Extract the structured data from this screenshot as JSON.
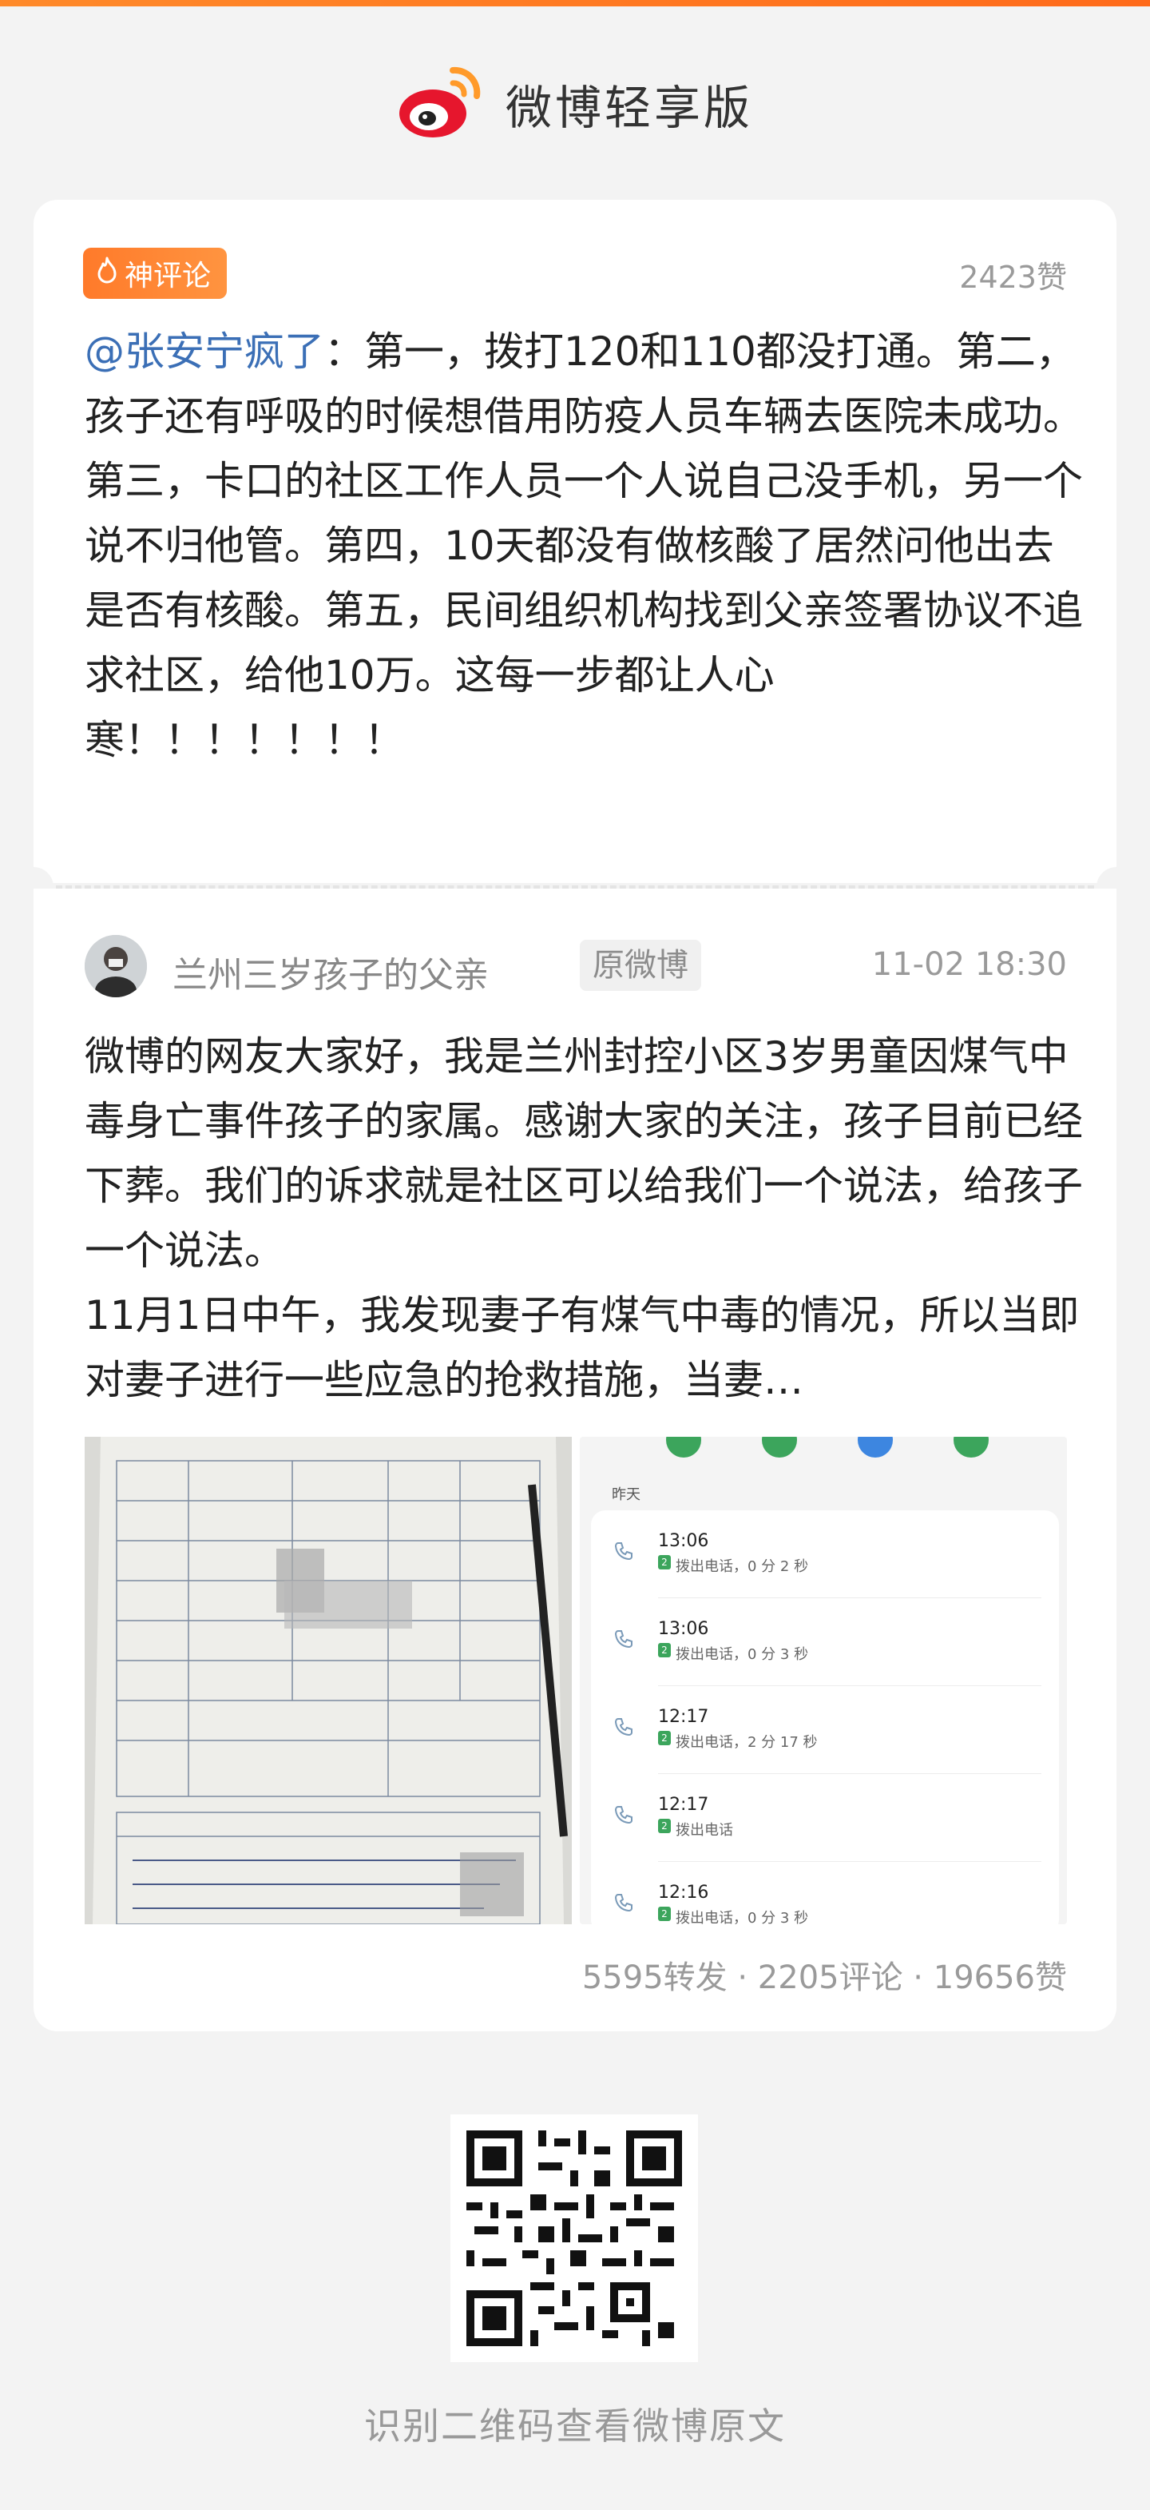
{
  "header": {
    "app_title": "微博轻享版"
  },
  "comment": {
    "badge": "神评论",
    "likes": "2423赞",
    "mention": "@张安宁疯了",
    "text": "：第一，拨打120和110都没打通。第二，孩子还有呼吸的时候想借用防疫人员车辆去医院未成功。第三，卡口的社区工作人员一个人说自己没手机，另一个说不归他管。第四，10天都没有做核酸了居然问他出去是否有核酸。第五，民间组织机构找到父亲签署协议不追求社区，给他10万。这每一步都让人心寒！！！！！！！"
  },
  "original": {
    "username": "兰州三岁孩子的父亲",
    "tag": "原微博",
    "time": "11-02 18:30",
    "text": "微博的网友大家好，我是兰州封控小区3岁男童因煤气中毒身亡事件孩子的家属。感谢大家的关注，孩子目前已经下葬。我们的诉求就是社区可以给我们一个说法，给孩子一个说法。\n11月1日中午，我发现妻子有煤气中毒的情况，所以当即对妻子进行一些应急的抢救措施，当妻…",
    "stats": "5595转发 · 2205评论 · 19656赞",
    "call_log": {
      "date_label": "昨天",
      "items": [
        {
          "time": "13:06",
          "sim": "2",
          "desc": "拨出电话，0 分 2 秒"
        },
        {
          "time": "13:06",
          "sim": "2",
          "desc": "拨出电话，0 分 3 秒"
        },
        {
          "time": "12:17",
          "sim": "2",
          "desc": "拨出电话，2 分 17 秒"
        },
        {
          "time": "12:17",
          "sim": "2",
          "desc": "拨出电话"
        },
        {
          "time": "12:16",
          "sim": "2",
          "desc": "拨出电话，0 分 3 秒"
        }
      ]
    }
  },
  "footer": {
    "qr_caption": "识别二维码查看微博原文"
  },
  "colors": {
    "accent": "#ff7a2a",
    "mention": "#3b6fb6",
    "muted": "#9a9a9a"
  }
}
